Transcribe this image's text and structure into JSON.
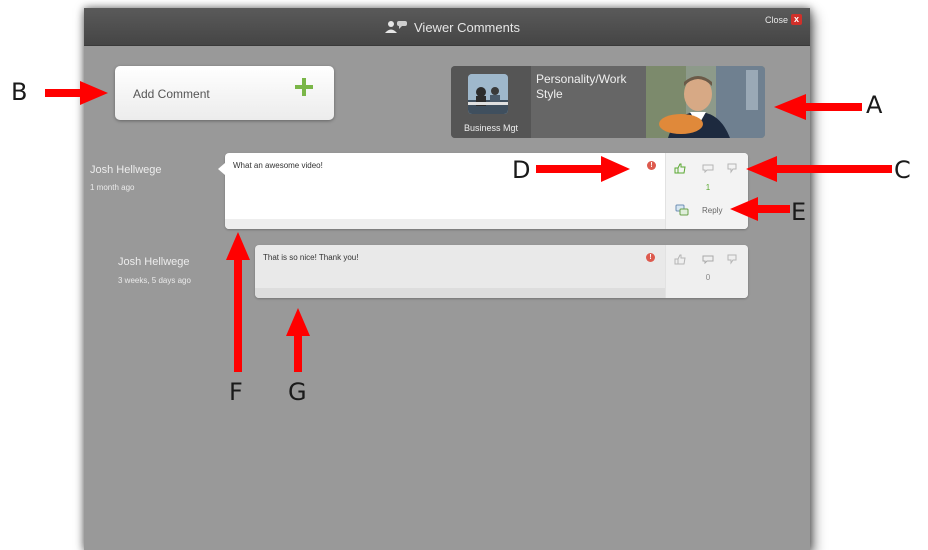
{
  "window": {
    "title": "Viewer Comments",
    "close_label": "Close",
    "close_icon": "x"
  },
  "add_comment": {
    "label": "Add Comment",
    "icon": "plus-icon",
    "accent": "#7ab648"
  },
  "video": {
    "thumb_label": "Business Mgt",
    "title": "Personality/Work Style"
  },
  "comments": [
    {
      "author": "Josh Hellwege",
      "time": "1 month ago",
      "text": "What an awesome video!",
      "votes": "1",
      "reply_label": "Reply"
    },
    {
      "author": "Josh Hellwege",
      "time": "3 weeks, 5 days ago",
      "text": "That is so nice! Thank you!",
      "votes": "0"
    }
  ],
  "annotations": [
    "A",
    "B",
    "C",
    "D",
    "E",
    "F",
    "G"
  ],
  "colors": {
    "arrow": "#ff0000",
    "flag": "#dd5a4e",
    "vote_positive": "#5aa832"
  }
}
